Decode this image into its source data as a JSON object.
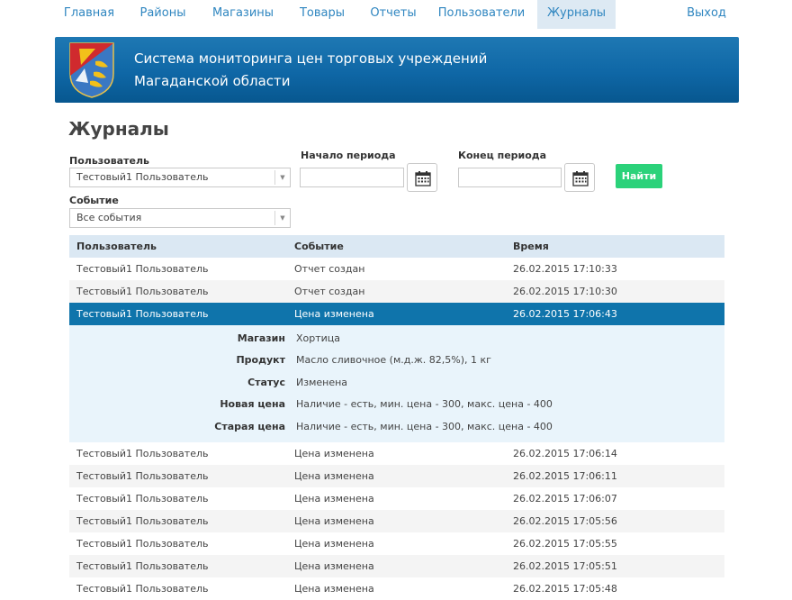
{
  "nav": {
    "items": [
      {
        "label": "Главная"
      },
      {
        "label": "Районы"
      },
      {
        "label": "Магазины"
      },
      {
        "label": "Товары"
      },
      {
        "label": "Отчеты"
      },
      {
        "label": "Пользователи"
      },
      {
        "label": "Журналы",
        "active": true
      }
    ],
    "logout": "Выход"
  },
  "banner": {
    "title_line1": "Система мониторинга цен торговых учреждений",
    "title_line2": "Магаданской области",
    "emblem_icon": "coat-of-arms-icon",
    "colors": {
      "emblem_red": "#d02a2e",
      "emblem_blue": "#3a78c3",
      "emblem_gold": "#f2c01a"
    }
  },
  "page": {
    "title": "Журналы"
  },
  "filters": {
    "user_label": "Пользователь",
    "user_value": "Тестовый1 Пользователь",
    "event_label": "Событие",
    "event_value": "Все события",
    "start_label": "Начало периода",
    "end_label": "Конец периода",
    "start_value": "",
    "end_value": "",
    "calendar_icon": "calendar-icon",
    "find_button": "Найти"
  },
  "table": {
    "headers": [
      "Пользователь",
      "Событие",
      "Время"
    ],
    "rows_before": [
      {
        "user": "Тестовый1 Пользователь",
        "event": "Отчет создан",
        "time": "26.02.2015 17:10:33"
      },
      {
        "user": "Тестовый1 Пользователь",
        "event": "Отчет создан",
        "time": "26.02.2015 17:10:30"
      }
    ],
    "selected": {
      "user": "Тестовый1 Пользователь",
      "event": "Цена изменена",
      "time": "26.02.2015 17:06:43"
    },
    "details": [
      {
        "label": "Магазин",
        "value": "Хортица"
      },
      {
        "label": "Продукт",
        "value": "Масло сливочное (м.д.ж. 82,5%), 1 кг"
      },
      {
        "label": "Статус",
        "value": "Изменена"
      },
      {
        "label": "Новая цена",
        "value": "Наличие - есть, мин. цена - 300, макс. цена - 400"
      },
      {
        "label": "Старая цена",
        "value": "Наличие - есть, мин. цена - 300, макс. цена - 400"
      }
    ],
    "rows_after": [
      {
        "user": "Тестовый1 Пользователь",
        "event": "Цена изменена",
        "time": "26.02.2015 17:06:14"
      },
      {
        "user": "Тестовый1 Пользователь",
        "event": "Цена изменена",
        "time": "26.02.2015 17:06:11"
      },
      {
        "user": "Тестовый1 Пользователь",
        "event": "Цена изменена",
        "time": "26.02.2015 17:06:07"
      },
      {
        "user": "Тестовый1 Пользователь",
        "event": "Цена изменена",
        "time": "26.02.2015 17:05:56"
      },
      {
        "user": "Тестовый1 Пользователь",
        "event": "Цена изменена",
        "time": "26.02.2015 17:05:55"
      },
      {
        "user": "Тестовый1 Пользователь",
        "event": "Цена изменена",
        "time": "26.02.2015 17:05:51"
      },
      {
        "user": "Тестовый1 Пользователь",
        "event": "Цена изменена",
        "time": "26.02.2015 17:05:48"
      }
    ]
  },
  "colors": {
    "accent": "#0f74ab",
    "link": "#2f86c0",
    "success": "#2bd27a"
  }
}
